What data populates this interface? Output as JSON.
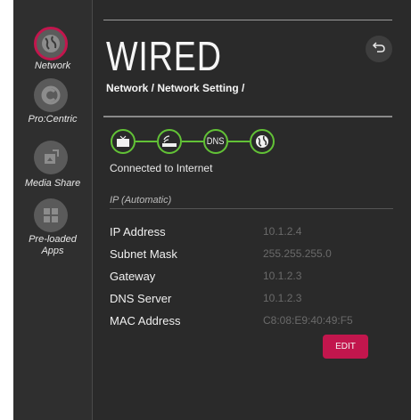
{
  "sidebar": {
    "items": [
      {
        "label": "Network",
        "icon": "globe-icon",
        "active": true
      },
      {
        "label": "Pro:Centric",
        "icon": "procentric-icon",
        "active": false
      },
      {
        "label": "Media Share",
        "icon": "media-share-icon",
        "active": false
      },
      {
        "label": "Pre-loaded\nApps",
        "icon": "apps-grid-icon",
        "active": false
      }
    ]
  },
  "header": {
    "title": "WIRED",
    "breadcrumb": "Network / Network Setting /",
    "back_icon": "back-arrow-icon"
  },
  "status": {
    "nodes": [
      "tv-icon",
      "router-icon",
      "DNS",
      "globe-icon"
    ],
    "text": "Connected to Internet",
    "color": "#62c236"
  },
  "ip_mode": "IP (Automatic)",
  "info": [
    {
      "label": "IP Address",
      "value": "10.1.2.4"
    },
    {
      "label": "Subnet Mask",
      "value": "255.255.255.0"
    },
    {
      "label": "Gateway",
      "value": "10.1.2.3"
    },
    {
      "label": "DNS Server",
      "value": "10.1.2.3"
    },
    {
      "label": "MAC Address",
      "value": "C8:08:E9:40:49:F5"
    }
  ],
  "edit_button": "EDIT",
  "colors": {
    "accent": "#c2164d",
    "connected": "#62c236",
    "background": "#2a2a2a"
  }
}
